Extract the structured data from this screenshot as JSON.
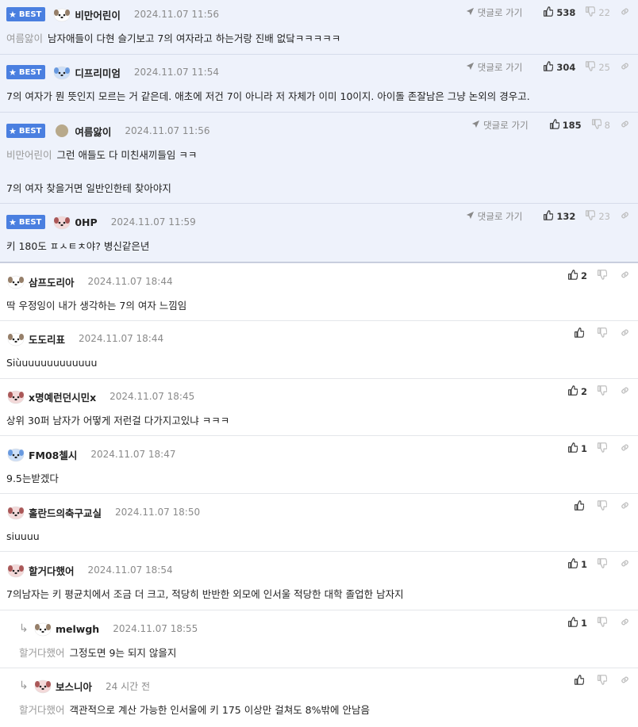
{
  "labels": {
    "best": "BEST",
    "reply": "댓글로 가기"
  },
  "comments": [
    {
      "best": true,
      "avatar": "dog",
      "nickname": "비만어린이",
      "date": "2024.11.07 11:56",
      "mention": "여름앓이",
      "text": "남자애들이 다현 슬기보고 7의 여자라고 하는거랑 진배 없닼ㅋㅋㅋㅋㅋ",
      "likes": "538",
      "dislikes": "22"
    },
    {
      "best": true,
      "avatar": "blue",
      "nickname": "디프리미엄",
      "date": "2024.11.07 11:54",
      "mention": "",
      "text": "7의 여자가 뭔 뜻인지 모르는 거 같은데. 애초에 저건 7이 아니라 저 자체가 이미 10이지. 아이돌 존잘남은 그냥 논외의 경우고.",
      "likes": "304",
      "dislikes": "25"
    },
    {
      "best": true,
      "avatar": "circle",
      "nickname": "여름앓이",
      "date": "2024.11.07 11:56",
      "mention": "비만어린이",
      "text": "그런 애들도 다 미친새끼들임 ㅋㅋ\n\n7의 여자 찾을거면 일반인한테 찾아야지",
      "likes": "185",
      "dislikes": "8"
    },
    {
      "best": true,
      "avatar": "red",
      "nickname": "0HP",
      "date": "2024.11.07 11:59",
      "mention": "",
      "text": "키 180도 ㅍㅅㅌㅊ야? 병신같은년",
      "likes": "132",
      "dislikes": "23"
    },
    {
      "best": false,
      "avatar": "dog",
      "nickname": "삼프도리아",
      "date": "2024.11.07 18:44",
      "mention": "",
      "text": "딱 우정잉이 내가 생각하는 7의 여자 느낌임",
      "likes": "2",
      "dislikes": ""
    },
    {
      "best": false,
      "avatar": "dog",
      "nickname": "도도리표",
      "date": "2024.11.07 18:44",
      "mention": "",
      "text": "Siùuuuuuuuuuuuu",
      "likes": "",
      "dislikes": ""
    },
    {
      "best": false,
      "avatar": "red",
      "nickname": "x명예런던시민x",
      "date": "2024.11.07 18:45",
      "mention": "",
      "text": "상위 30퍼 남자가 어떻게 저런걸 다가지고있냐 ㅋㅋㅋ",
      "likes": "2",
      "dislikes": ""
    },
    {
      "best": false,
      "avatar": "blue",
      "nickname": "FM08첼시",
      "date": "2024.11.07 18:47",
      "mention": "",
      "text": "9.5는받겠다",
      "likes": "1",
      "dislikes": ""
    },
    {
      "best": false,
      "avatar": "red",
      "nickname": "홀란드의축구교실",
      "date": "2024.11.07 18:50",
      "mention": "",
      "text": "siuuuu",
      "likes": "",
      "dislikes": ""
    },
    {
      "best": false,
      "avatar": "red",
      "nickname": "할거다했어",
      "date": "2024.11.07 18:54",
      "mention": "",
      "text": "7의남자는 키 평균치에서 조금 더 크고, 적당히 반반한 외모에 인서울 적당한 대학 졸업한 남자지",
      "likes": "1",
      "dislikes": ""
    },
    {
      "best": false,
      "reply": true,
      "avatar": "dog",
      "nickname": "melwgh",
      "date": "2024.11.07 18:55",
      "mention": "할거다했어",
      "text": "그정도면 9는 되지 않을지",
      "likes": "1",
      "dislikes": ""
    },
    {
      "best": false,
      "reply": true,
      "avatar": "red",
      "nickname": "보스니아",
      "date": "24 시간 전",
      "mention": "할거다했어",
      "text": "객관적으로 계산 가능한 인서울에 키 175 이상만 걸쳐도 8%밖에 안남음",
      "likes": "",
      "dislikes": ""
    }
  ]
}
